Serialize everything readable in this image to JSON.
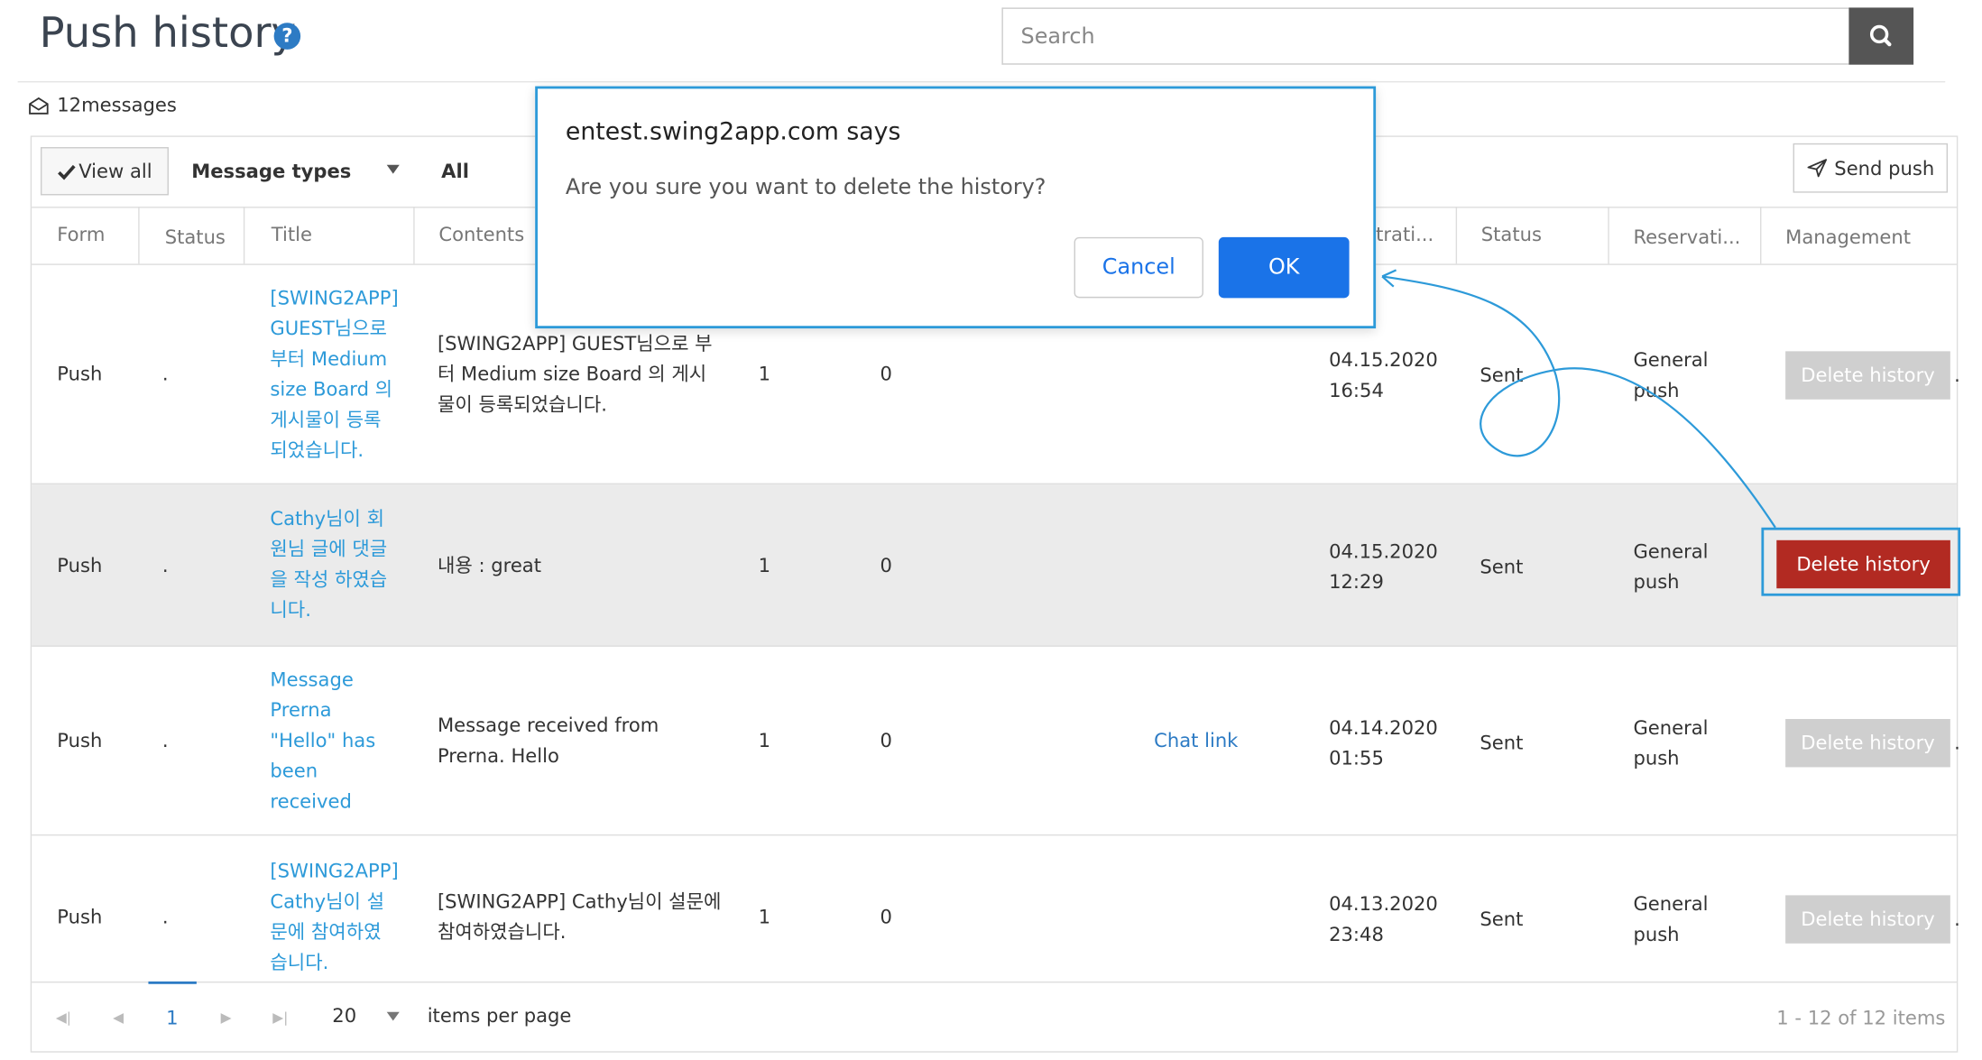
{
  "header": {
    "title": "Push history",
    "help_glyph": "?",
    "search_placeholder": "Search",
    "search_icon": "search-icon"
  },
  "summary": {
    "count_label": "12messages",
    "icon": "envelope-icon"
  },
  "toolbar": {
    "view_all": "View all",
    "message_types": "Message types",
    "filter_value": "All",
    "send_push": "Send push"
  },
  "columns": [
    "Form",
    "Status",
    "Title",
    "Contents",
    "trati...",
    "Status",
    "Reservati...",
    "Management"
  ],
  "rows": [
    {
      "form": "Push",
      "status": ".",
      "title": [
        "[SWING2APP]",
        "GUEST님으로",
        "부터 Medium",
        "size Board 의",
        "게시물이 등록",
        "되었습니다."
      ],
      "contents": [
        "[SWING2APP] GUEST님으로 부",
        "터 Medium size Board 의 게시",
        "물이 등록되었습니다."
      ],
      "c1": "1",
      "c2": "0",
      "link": "",
      "date": "04.15.2020",
      "time": "16:54",
      "sent": "Sent",
      "res1": "General",
      "res2": "push",
      "action": "Delete history"
    },
    {
      "form": "Push",
      "status": ".",
      "title": [
        "Cathy님이 회",
        "원님 글에 댓글",
        "을 작성 하였습",
        "니다."
      ],
      "contents": [
        "내용 : great"
      ],
      "c1": "1",
      "c2": "0",
      "link": "",
      "date": "04.15.2020",
      "time": "12:29",
      "sent": "Sent",
      "res1": "General",
      "res2": "push",
      "action": "Delete history"
    },
    {
      "form": "Push",
      "status": ".",
      "title": [
        "Message",
        "Prerna",
        "\"Hello\" has",
        "been",
        "received"
      ],
      "contents": [
        "Message received from",
        "Prerna. Hello"
      ],
      "c1": "1",
      "c2": "0",
      "link": "Chat link",
      "date": "04.14.2020",
      "time": "01:55",
      "sent": "Sent",
      "res1": "General",
      "res2": "push",
      "action": "Delete history"
    },
    {
      "form": "Push",
      "status": ".",
      "title": [
        "[SWING2APP]",
        "Cathy님이 설",
        "문에 참여하였",
        "습니다."
      ],
      "contents": [
        "[SWING2APP] Cathy님이 설문에",
        "참여하였습니다."
      ],
      "c1": "1",
      "c2": "0",
      "link": "",
      "date": "04.13.2020",
      "time": "23:48",
      "sent": "Sent",
      "res1": "General",
      "res2": "push",
      "action": "Delete history"
    }
  ],
  "pagination": {
    "current_page": "1",
    "page_size": "20",
    "per_page_label": "items per page",
    "info": "1 - 12 of 12 items"
  },
  "dialog": {
    "title": "entest.swing2app.com says",
    "message": "Are you sure you want to delete the history?",
    "cancel": "Cancel",
    "ok": "OK"
  },
  "colors": {
    "accent": "#2d9ad9",
    "delete_active": "#b22a22",
    "delete_disabled": "#cfcfcf",
    "dialog_ok": "#1a73e8"
  }
}
